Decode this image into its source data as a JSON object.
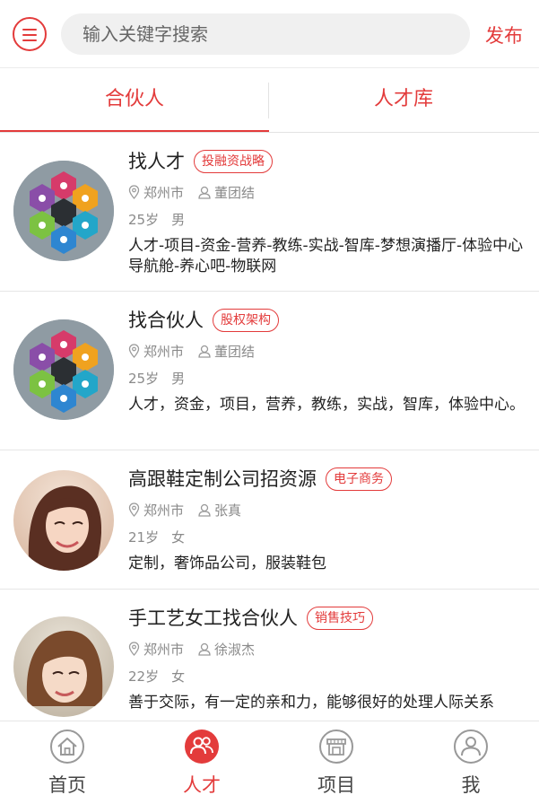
{
  "header": {
    "search_placeholder": "输入关键字搜索",
    "publish_label": "发布"
  },
  "tabs": [
    {
      "label": "合伙人",
      "active": true
    },
    {
      "label": "人才库",
      "active": false
    }
  ],
  "colors": {
    "accent": "#e33b3b",
    "divider": "#e6e6e6",
    "muted_text": "#8a8a8a"
  },
  "items": [
    {
      "title": "找人才",
      "tag": "投融资战略",
      "city": "郑州市",
      "person": "董团结",
      "age": "25岁",
      "gender": "男",
      "desc": "人才-项目-资金-营养-教练-实战-智库-梦想演播厅-体验中心导航舱-养心吧-物联网",
      "avatar": "hexagon-infographic"
    },
    {
      "title": "找合伙人",
      "tag": "股权架构",
      "city": "郑州市",
      "person": "董团结",
      "age": "25岁",
      "gender": "男",
      "desc": "人才，资金，项目，营养，教练，实战，智库，体验中心。",
      "avatar": "hexagon-infographic"
    },
    {
      "title": "高跟鞋定制公司招资源",
      "tag": "电子商务",
      "city": "郑州市",
      "person": "张真",
      "age": "21岁",
      "gender": "女",
      "desc": "定制，奢饰品公司，服装鞋包",
      "avatar": "woman-photo"
    },
    {
      "title": "手工艺女工找合伙人",
      "tag": "销售技巧",
      "city": "郑州市",
      "person": "徐淑杰",
      "age": "22岁",
      "gender": "女",
      "desc": "善于交际，有一定的亲和力，能够很好的处理人际关系",
      "avatar": "woman-photo"
    }
  ],
  "bottom_nav": [
    {
      "label": "首页",
      "icon": "home-icon",
      "active": false
    },
    {
      "label": "人才",
      "icon": "people-icon",
      "active": true
    },
    {
      "label": "项目",
      "icon": "store-icon",
      "active": false
    },
    {
      "label": "我",
      "icon": "user-icon",
      "active": false
    }
  ]
}
